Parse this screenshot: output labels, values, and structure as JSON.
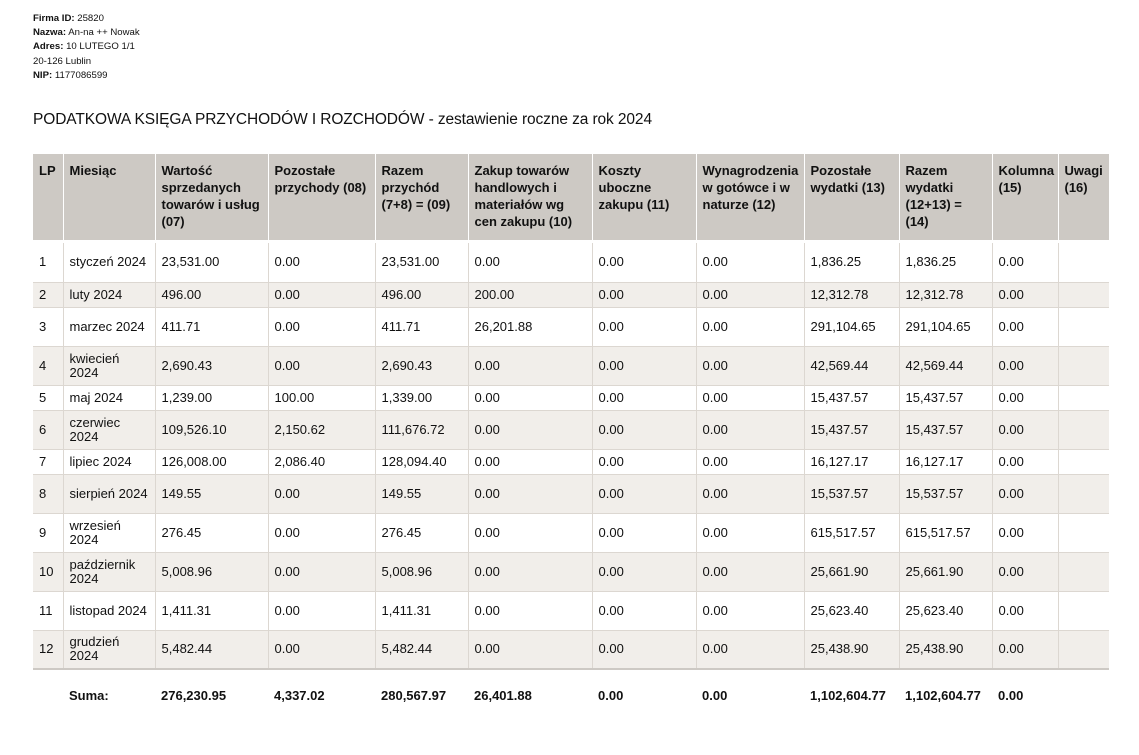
{
  "company": {
    "id_label": "Firma ID:",
    "id_value": "25820",
    "name_label": "Nazwa:",
    "name_value": "An-na ++ Nowak",
    "address_label": "Adres:",
    "address_value": "10 LUTEGO 1/1",
    "city_line": "20-126  Lublin",
    "nip_label": "NIP:",
    "nip_value": "1177086599"
  },
  "title": "PODATKOWA KSIĘGA PRZYCHODÓW I ROZCHODÓW - zestawienie roczne za rok 2024",
  "columns": [
    "LP",
    "Miesiąc",
    "Wartość sprzedanych towarów i usług (07)",
    "Pozostałe przychody (08)",
    "Razem przychód (7+8) = (09)",
    "Zakup towarów handlowych i materiałów wg cen zakupu (10)",
    "Koszty uboczne zakupu (11)",
    "Wynagrodzenia w gotówce i w naturze (12)",
    "Pozostałe wydatki (13)",
    "Razem wydatki (12+13) = (14)",
    "Kolumna (15)",
    "Uwagi (16)"
  ],
  "rows": [
    [
      "1",
      "styczeń 2024",
      "23,531.00",
      "0.00",
      "23,531.00",
      "0.00",
      "0.00",
      "0.00",
      "1,836.25",
      "1,836.25",
      "0.00",
      ""
    ],
    [
      "2",
      "luty 2024",
      "496.00",
      "0.00",
      "496.00",
      "200.00",
      "0.00",
      "0.00",
      "12,312.78",
      "12,312.78",
      "0.00",
      ""
    ],
    [
      "3",
      "marzec 2024",
      "411.71",
      "0.00",
      "411.71",
      "26,201.88",
      "0.00",
      "0.00",
      "291,104.65",
      "291,104.65",
      "0.00",
      ""
    ],
    [
      "4",
      "kwiecień 2024",
      "2,690.43",
      "0.00",
      "2,690.43",
      "0.00",
      "0.00",
      "0.00",
      "42,569.44",
      "42,569.44",
      "0.00",
      ""
    ],
    [
      "5",
      "maj 2024",
      "1,239.00",
      "100.00",
      "1,339.00",
      "0.00",
      "0.00",
      "0.00",
      "15,437.57",
      "15,437.57",
      "0.00",
      ""
    ],
    [
      "6",
      "czerwiec 2024",
      "109,526.10",
      "2,150.62",
      "111,676.72",
      "0.00",
      "0.00",
      "0.00",
      "15,437.57",
      "15,437.57",
      "0.00",
      ""
    ],
    [
      "7",
      "lipiec 2024",
      "126,008.00",
      "2,086.40",
      "128,094.40",
      "0.00",
      "0.00",
      "0.00",
      "16,127.17",
      "16,127.17",
      "0.00",
      ""
    ],
    [
      "8",
      "sierpień 2024",
      "149.55",
      "0.00",
      "149.55",
      "0.00",
      "0.00",
      "0.00",
      "15,537.57",
      "15,537.57",
      "0.00",
      ""
    ],
    [
      "9",
      "wrzesień 2024",
      "276.45",
      "0.00",
      "276.45",
      "0.00",
      "0.00",
      "0.00",
      "615,517.57",
      "615,517.57",
      "0.00",
      ""
    ],
    [
      "10",
      "październik 2024",
      "5,008.96",
      "0.00",
      "5,008.96",
      "0.00",
      "0.00",
      "0.00",
      "25,661.90",
      "25,661.90",
      "0.00",
      ""
    ],
    [
      "11",
      "listopad 2024",
      "1,411.31",
      "0.00",
      "1,411.31",
      "0.00",
      "0.00",
      "0.00",
      "25,623.40",
      "25,623.40",
      "0.00",
      ""
    ],
    [
      "12",
      "grudzień 2024",
      "5,482.44",
      "0.00",
      "5,482.44",
      "0.00",
      "0.00",
      "0.00",
      "25,438.90",
      "25,438.90",
      "0.00",
      ""
    ]
  ],
  "total": [
    "",
    "Suma:",
    "276,230.95",
    "4,337.02",
    "280,567.97",
    "26,401.88",
    "0.00",
    "0.00",
    "1,102,604.77",
    "1,102,604.77",
    "0.00",
    ""
  ]
}
